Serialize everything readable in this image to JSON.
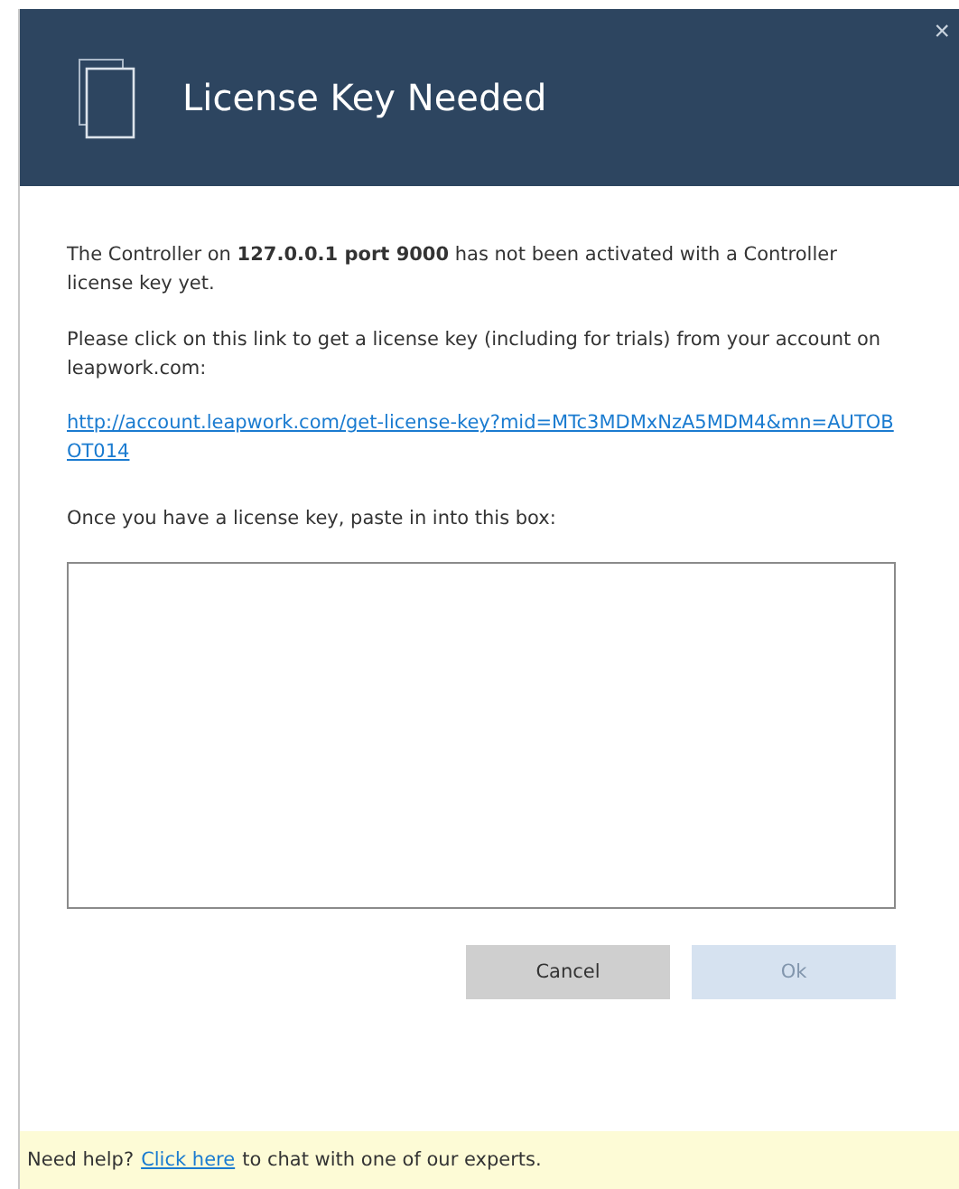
{
  "window": {
    "title": "License Key Needed",
    "close": "×"
  },
  "body": {
    "message": "The Controller on **127.0.0.1 port 9000** has not been activated with a Controller license key yet.",
    "instruction": "Please click on this link to get a license key (including for trials) from your account on leapwork.com:",
    "link": "http://account.leapwork.com/get-license-key?mid=MTc3MDMxNzA5MDM4&mn=AUTOBOT014",
    "prompt": "Once you have a license key, paste in into this box:"
  },
  "buttons": [
    {
      "label": "Cancel",
      "disabled": false
    },
    {
      "label": "Ok",
      "disabled": true
    }
  ],
  "footer": {
    "lead": "Need help?",
    "link": "Click here",
    "rest": "to chat with one of our experts."
  }
}
